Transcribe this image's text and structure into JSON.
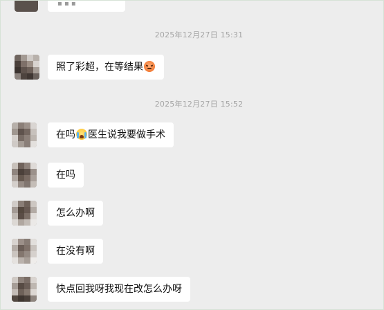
{
  "chat": {
    "timestamps": [
      "2025年12月27日 15:31",
      "2025年12月27日 15:52"
    ],
    "messages": [
      {
        "text": "照了彩超，在等结果",
        "emoji": "angry-face-emoji"
      },
      {
        "text_before": "在吗",
        "emoji": "crying-face-emoji",
        "text_after": "医生说我要做手术"
      },
      {
        "text": "在吗"
      },
      {
        "text": "怎么办啊"
      },
      {
        "text": "在没有啊"
      },
      {
        "text": "快点回我呀我现在改怎么办呀"
      }
    ]
  },
  "colors": {
    "background": "#ededed",
    "bubble": "#ffffff",
    "timestamp_text": "#a5a5a5",
    "message_text": "#111111"
  }
}
